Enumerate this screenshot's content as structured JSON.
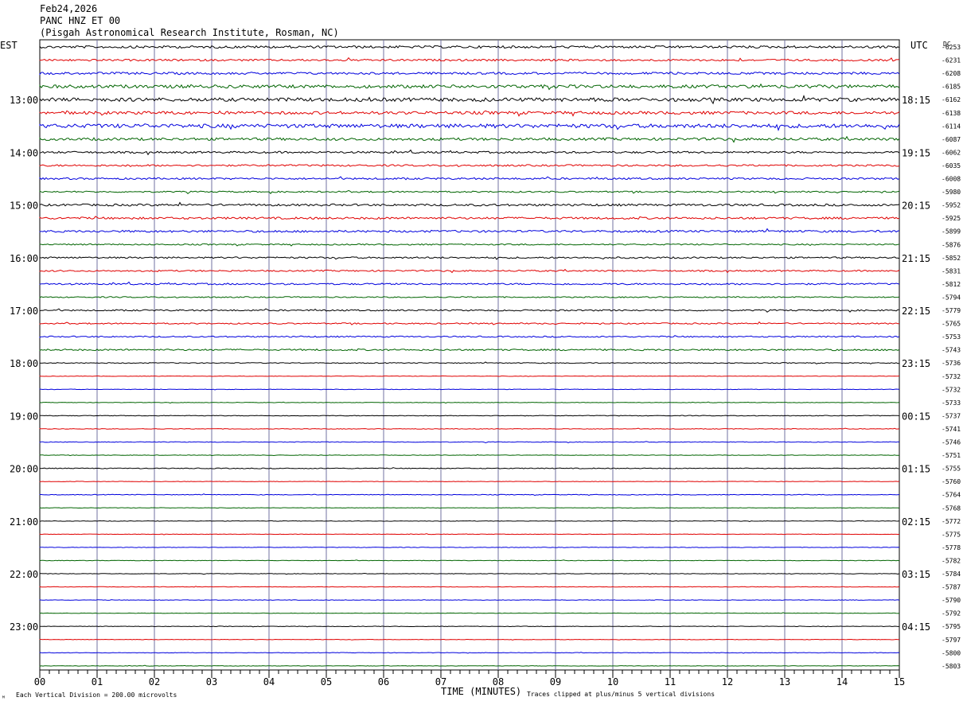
{
  "header": {
    "date": "Feb24,2026",
    "station": "PANC HNZ ET 00",
    "location": "(Pisgah Astronomical Research Institute, Rosman, NC)"
  },
  "left_timezone": "EST",
  "right_timezone": "UTC",
  "dc_label": "DC",
  "footer": {
    "corner_mark": "ᴹ",
    "scale_note": "Each Vertical Division =  200.00 microvolts",
    "xlabel": "TIME (MINUTES)",
    "clip_note": "Traces clipped at plus/minus 5 vertical divisions"
  },
  "colors": {
    "trace_cycle": [
      "#000000",
      "#e00000",
      "#0000dd",
      "#006400"
    ],
    "grid": "#7070a0",
    "border": "#000000"
  },
  "chart_data": {
    "type": "line",
    "title": "PANC HNZ ET 00",
    "xlabel": "TIME (MINUTES)",
    "ylabel": "",
    "xlim": [
      0,
      15
    ],
    "x_ticks": [
      "00",
      "01",
      "02",
      "03",
      "04",
      "05",
      "06",
      "07",
      "08",
      "09",
      "10",
      "11",
      "12",
      "13",
      "14",
      "15"
    ],
    "left_hour_labels": [
      "13:00",
      "14:00",
      "15:00",
      "16:00",
      "17:00",
      "18:00",
      "19:00",
      "20:00",
      "21:00",
      "22:00",
      "23:00"
    ],
    "right_hour_labels": [
      "18:15",
      "19:15",
      "20:15",
      "21:15",
      "22:15",
      "23:15",
      "00:15",
      "01:15",
      "02:15",
      "03:15",
      "04:15"
    ],
    "hour_label_first_trace": 4,
    "dc_offsets": [
      "-6253",
      "-6231",
      "-6208",
      "-6185",
      "-6162",
      "-6138",
      "-6114",
      "-6087",
      "-6062",
      "-6035",
      "-6008",
      "-5980",
      "-5952",
      "-5925",
      "-5899",
      "-5876",
      "-5852",
      "-5831",
      "-5812",
      "-5794",
      "-5779",
      "-5765",
      "-5753",
      "-5743",
      "-5736",
      "-5732",
      "-5732",
      "-5733",
      "-5737",
      "-5741",
      "-5746",
      "-5751",
      "-5755",
      "-5760",
      "-5764",
      "-5768",
      "-5772",
      "-5775",
      "-5778",
      "-5782",
      "-5784",
      "-5787",
      "-5790",
      "-5792",
      "-5795",
      "-5797",
      "-5800",
      "-5803"
    ],
    "trace_noise_amplitude": [
      1.5,
      1.2,
      1.4,
      2.0,
      2.2,
      1.8,
      2.4,
      1.6,
      1.2,
      1.1,
      1.1,
      0.9,
      1.3,
      1.3,
      1.3,
      0.8,
      1.0,
      0.9,
      1.0,
      0.7,
      0.9,
      0.8,
      0.8,
      1.0,
      0.5,
      0.3,
      0.3,
      0.3,
      0.4,
      0.4,
      0.4,
      0.3,
      0.5,
      0.3,
      0.4,
      0.3,
      0.3,
      0.3,
      0.3,
      0.3,
      0.3,
      0.3,
      0.3,
      0.3,
      0.3,
      0.3,
      0.3,
      0.3
    ],
    "grid": true
  }
}
